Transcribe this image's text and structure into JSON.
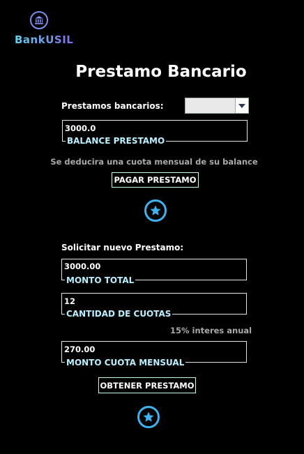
{
  "brand": {
    "name": "BankUSIL",
    "logo_icon": "bank-icon"
  },
  "page_title": "Prestamo Bancario",
  "loans": {
    "select_label": "Prestamos bancarios:",
    "select_value": "",
    "balance_value": "3000.0",
    "balance_label": "BALANCE PRESTAMO",
    "note": "Se deducira una cuota mensual de su balance",
    "pay_button": "PAGAR PRESTAMO"
  },
  "new_loan": {
    "heading": "Solicitar nuevo Prestamo:",
    "total_value": "3000.00",
    "total_label": "MONTO TOTAL",
    "installments_value": "12",
    "installments_label": "CANTIDAD DE CUOTAS",
    "interest_note": "15% interes anual",
    "monthly_value": "270.00",
    "monthly_label": "MONTO CUOTA MENSUAL",
    "obtain_button": "OBTENER PRESTAMO"
  },
  "icons": {
    "star": "star-icon",
    "dropdown": "chevron-down-icon"
  },
  "colors": {
    "accent": "#3bb3f0",
    "label": "#b8f0ff",
    "background": "#000000"
  }
}
